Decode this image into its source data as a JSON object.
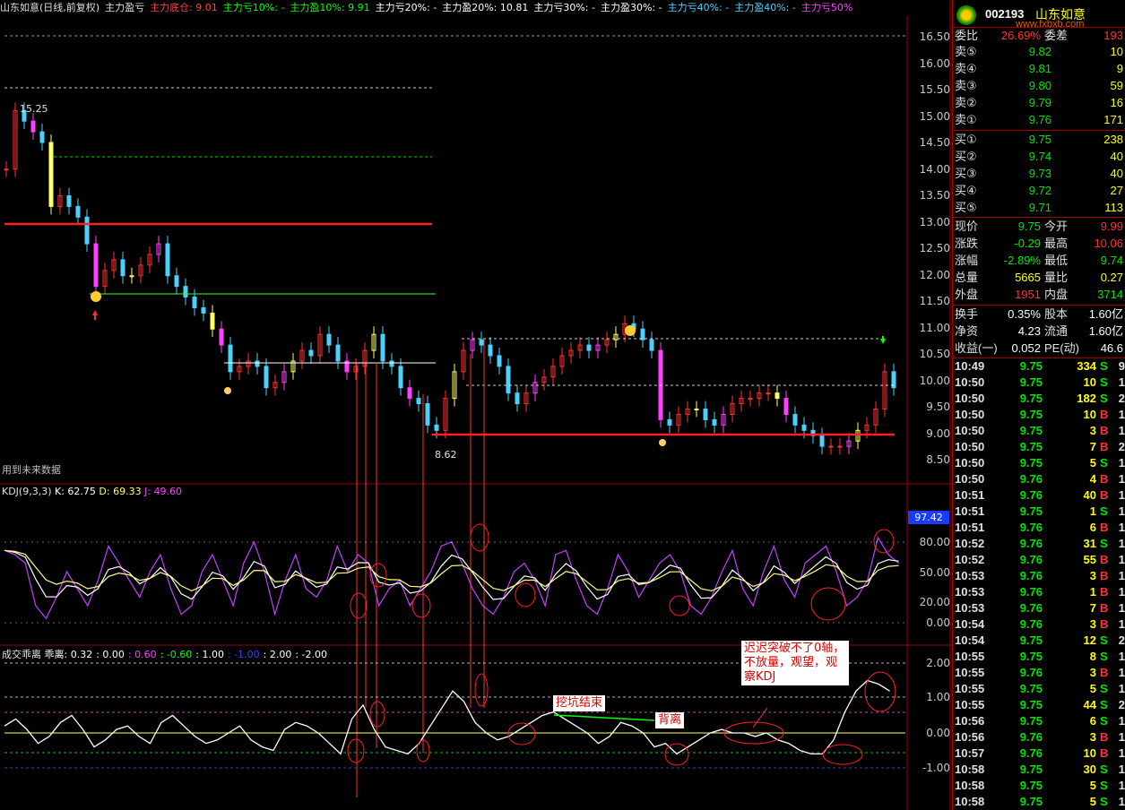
{
  "title_bar": {
    "stock": "山东如意(日线,前复权)",
    "indicator": "主力盈亏",
    "items": [
      {
        "text": "主力底仓: 9.01",
        "color": "#ff4040"
      },
      {
        "text": "主力亏10%: -",
        "color": "#00ff00"
      },
      {
        "text": "主力盈10%: 9.91",
        "color": "#00ff00"
      },
      {
        "text": "主力亏20%: -",
        "color": "#ffffff"
      },
      {
        "text": "主力盈20%: 10.81",
        "color": "#ffffff"
      },
      {
        "text": "主力亏30%: -",
        "color": "#ffffff"
      },
      {
        "text": "主力盈30%: -",
        "color": "#ffffff"
      },
      {
        "text": "主力亏40%: -",
        "color": "#4ad2ff"
      },
      {
        "text": "主力盈40%: -",
        "color": "#4ad2ff"
      },
      {
        "text": "主力亏50%",
        "color": "#ff40ff"
      }
    ]
  },
  "main_chart": {
    "y_ticks": [
      "16.50",
      "16.00",
      "15.50",
      "15.00",
      "14.50",
      "14.00",
      "13.50",
      "13.00",
      "12.50",
      "12.00",
      "11.50",
      "11.00",
      "10.50",
      "10.00",
      "9.50",
      "9.00",
      "8.50"
    ],
    "high_label": "15.25",
    "low_label": "8.62",
    "future_data_label": "用到未来数据",
    "kdj_tag": "97.42"
  },
  "kdj_panel": {
    "title": "KDJ(9,3,3)",
    "k": "K: 62.75",
    "d": "D: 69.33",
    "j": "J: 49.60",
    "y_ticks": [
      "80.00",
      "50.00",
      "20.00",
      "0.00"
    ]
  },
  "vol_panel": {
    "title": "成交乖离",
    "name": "乖离",
    "values": [
      {
        "text": ": 0.32",
        "color": "#ffffff"
      },
      {
        "text": ": 0.00",
        "color": "#ffffff"
      },
      {
        "text": ": 0.60",
        "color": "#ff40ff"
      },
      {
        "text": ": -0.60",
        "color": "#00ff00"
      },
      {
        "text": ": 1.00",
        "color": "#ffffff"
      },
      {
        "text": ": -1.00",
        "color": "#4040ff"
      },
      {
        "text": ": 2.00",
        "color": "#ffffff"
      },
      {
        "text": ": -2.00",
        "color": "#ffffff"
      }
    ],
    "y_ticks": [
      "2.00",
      "1.00",
      "0.00",
      "-1.00"
    ],
    "notes": {
      "dig_end": "挖坑结束",
      "divergence": "背离",
      "delay": "迟迟突破不了0轴，不放量，观望，观察KDJ"
    }
  },
  "quote_panel": {
    "code": "002193",
    "name": "山东如意",
    "watermark": "www.fxbxb.com",
    "weibi_label": "委比",
    "weibi_value": "26.69%",
    "weicha_label": "委差",
    "weicha_value": "193",
    "asks": [
      {
        "label": "卖⑤",
        "price": "9.82",
        "vol": "10"
      },
      {
        "label": "卖④",
        "price": "9.81",
        "vol": "9"
      },
      {
        "label": "卖③",
        "price": "9.80",
        "vol": "59"
      },
      {
        "label": "卖②",
        "price": "9.79",
        "vol": "16"
      },
      {
        "label": "卖①",
        "price": "9.76",
        "vol": "171"
      }
    ],
    "bids": [
      {
        "label": "买①",
        "price": "9.75",
        "vol": "238"
      },
      {
        "label": "买②",
        "price": "9.74",
        "vol": "40"
      },
      {
        "label": "买③",
        "price": "9.73",
        "vol": "40"
      },
      {
        "label": "买④",
        "price": "9.72",
        "vol": "27"
      },
      {
        "label": "买⑤",
        "price": "9.71",
        "vol": "113"
      }
    ],
    "stats": [
      {
        "l1": "现价",
        "v1": "9.75",
        "c1": "#00e600",
        "l2": "今开",
        "v2": "9.99",
        "c2": "#ff3232"
      },
      {
        "l1": "涨跌",
        "v1": "-0.29",
        "c1": "#00e600",
        "l2": "最高",
        "v2": "10.06",
        "c2": "#ff3232"
      },
      {
        "l1": "涨幅",
        "v1": "-2.89%",
        "c1": "#00e600",
        "l2": "最低",
        "v2": "9.74",
        "c2": "#00e600"
      },
      {
        "l1": "总量",
        "v1": "5665",
        "c1": "#ffff00",
        "l2": "量比",
        "v2": "0.27",
        "c2": "#ffff00"
      },
      {
        "l1": "外盘",
        "v1": "1951",
        "c1": "#ff3232",
        "l2": "内盘",
        "v2": "3714",
        "c2": "#00e600"
      }
    ],
    "stats2": [
      {
        "l1": "换手",
        "v1": "0.35%",
        "c1": "#ffffff",
        "l2": "股本",
        "v2": "1.60亿",
        "c2": "#ffffff"
      },
      {
        "l1": "净资",
        "v1": "4.23",
        "c1": "#ffffff",
        "l2": "流通",
        "v2": "1.60亿",
        "c2": "#ffffff"
      },
      {
        "l1": "收益(一)",
        "v1": "0.052",
        "c1": "#ffffff",
        "l2": "PE(动)",
        "v2": "46.6",
        "c2": "#ffffff"
      }
    ],
    "ticks": [
      {
        "t": "10:49",
        "p": "9.75",
        "v": "334",
        "s": "S",
        "n": "9"
      },
      {
        "t": "10:50",
        "p": "9.75",
        "v": "10",
        "s": "S",
        "n": "1"
      },
      {
        "t": "10:50",
        "p": "9.75",
        "v": "182",
        "s": "S",
        "n": "2"
      },
      {
        "t": "10:50",
        "p": "9.75",
        "v": "10",
        "s": "B",
        "n": "1"
      },
      {
        "t": "10:50",
        "p": "9.75",
        "v": "3",
        "s": "B",
        "n": "1"
      },
      {
        "t": "10:50",
        "p": "9.75",
        "v": "7",
        "s": "B",
        "n": "2"
      },
      {
        "t": "10:50",
        "p": "9.75",
        "v": "5",
        "s": "S",
        "n": "1"
      },
      {
        "t": "10:50",
        "p": "9.76",
        "v": "4",
        "s": "B",
        "n": "1"
      },
      {
        "t": "10:51",
        "p": "9.76",
        "v": "40",
        "s": "B",
        "n": "1"
      },
      {
        "t": "10:51",
        "p": "9.75",
        "v": "1",
        "s": "S",
        "n": "1"
      },
      {
        "t": "10:51",
        "p": "9.76",
        "v": "6",
        "s": "B",
        "n": "1"
      },
      {
        "t": "10:52",
        "p": "9.76",
        "v": "31",
        "s": "S",
        "n": "1"
      },
      {
        "t": "10:52",
        "p": "9.76",
        "v": "55",
        "s": "B",
        "n": "1"
      },
      {
        "t": "10:53",
        "p": "9.76",
        "v": "3",
        "s": "B",
        "n": "1"
      },
      {
        "t": "10:53",
        "p": "9.76",
        "v": "1",
        "s": "B",
        "n": "1"
      },
      {
        "t": "10:53",
        "p": "9.76",
        "v": "7",
        "s": "B",
        "n": "1"
      },
      {
        "t": "10:54",
        "p": "9.76",
        "v": "3",
        "s": "B",
        "n": "1"
      },
      {
        "t": "10:54",
        "p": "9.75",
        "v": "12",
        "s": "S",
        "n": "2"
      },
      {
        "t": "10:55",
        "p": "9.75",
        "v": "8",
        "s": "S",
        "n": "1"
      },
      {
        "t": "10:55",
        "p": "9.76",
        "v": "3",
        "s": "B",
        "n": "1"
      },
      {
        "t": "10:55",
        "p": "9.75",
        "v": "5",
        "s": "S",
        "n": "1"
      },
      {
        "t": "10:55",
        "p": "9.75",
        "v": "44",
        "s": "S",
        "n": "2"
      },
      {
        "t": "10:56",
        "p": "9.75",
        "v": "6",
        "s": "S",
        "n": "1"
      },
      {
        "t": "10:56",
        "p": "9.76",
        "v": "3",
        "s": "B",
        "n": "1"
      },
      {
        "t": "10:57",
        "p": "9.76",
        "v": "10",
        "s": "B",
        "n": "1"
      },
      {
        "t": "10:58",
        "p": "9.75",
        "v": "30",
        "s": "S",
        "n": "1"
      },
      {
        "t": "10:58",
        "p": "9.75",
        "v": "5",
        "s": "S",
        "n": "1"
      },
      {
        "t": "10:58",
        "p": "9.75",
        "v": "5",
        "s": "S",
        "n": "1"
      }
    ]
  }
}
